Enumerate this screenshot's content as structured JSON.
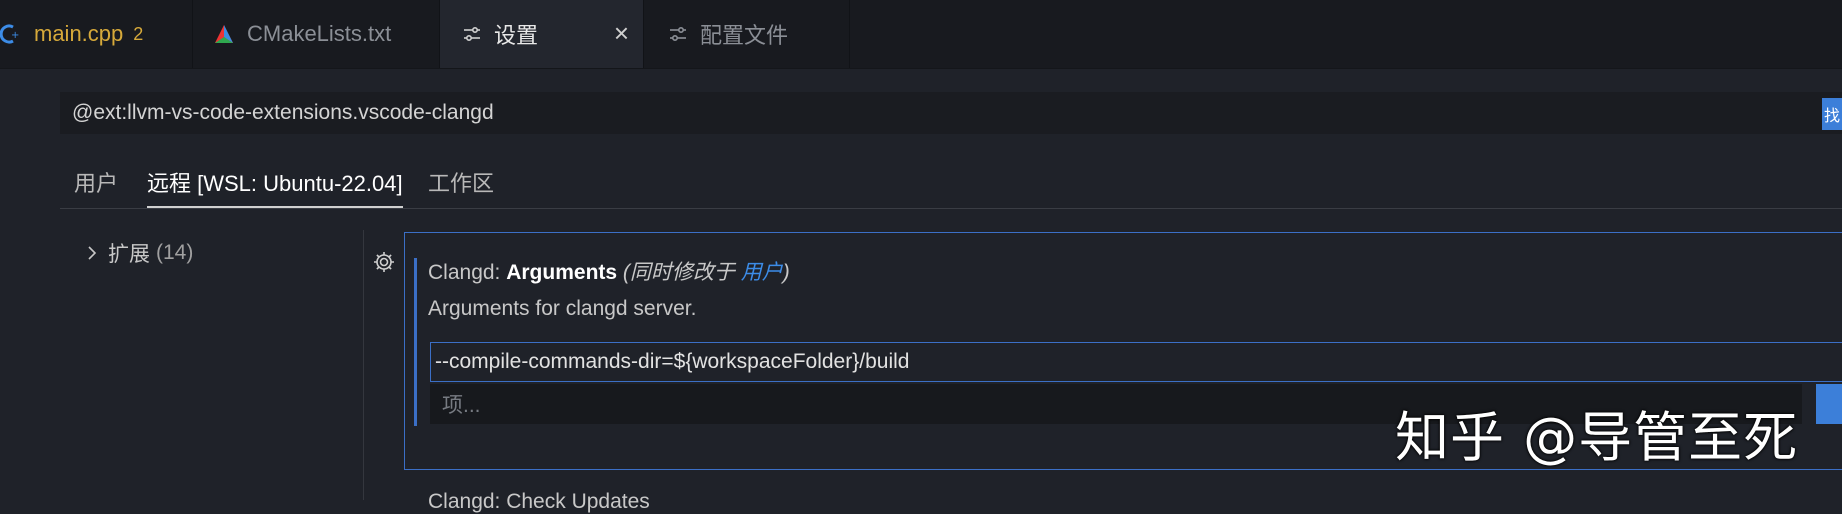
{
  "tabs": [
    {
      "label": "main.cpp",
      "badge": "2",
      "icon": "cpp-icon"
    },
    {
      "label": "CMakeLists.txt",
      "icon": "cmake-icon"
    },
    {
      "label": "设置",
      "icon": "settings-sliders-icon",
      "close": "×"
    },
    {
      "label": "配置文件",
      "icon": "settings-sliders-icon"
    }
  ],
  "search": {
    "value": "@ext:llvm-vs-code-extensions.vscode-clangd",
    "button": "找"
  },
  "scopes": [
    "用户",
    "远程 [WSL: Ubuntu-22.04]",
    "工作区"
  ],
  "tree": {
    "label": "扩展",
    "count": "(14)"
  },
  "setting": {
    "prefix": "Clangd: ",
    "name": "Arguments",
    "modified_open": "(同时修改于 ",
    "modified_link": "用户",
    "modified_close": ")",
    "description": "Arguments for clangd server.",
    "item_value": "--compile-commands-dir=${workspaceFolder}/build",
    "add_placeholder": "项..."
  },
  "next_setting": "Clangd: Check Updates",
  "watermark": "知乎 @导管至死",
  "colors": {
    "accent": "#3b6fc6",
    "link": "#3c8ce7",
    "modified": "#d6a93a"
  }
}
